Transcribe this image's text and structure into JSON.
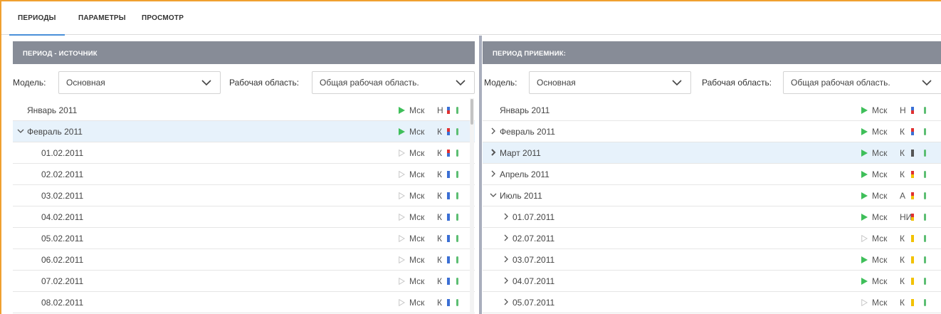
{
  "tabs": [
    {
      "label": "ПЕРИОДЫ",
      "active": true
    },
    {
      "label": "ПАРАМЕТРЫ",
      "active": false
    },
    {
      "label": "ПРОСМОТР",
      "active": false
    }
  ],
  "colors": {
    "accent": "#4a90d9",
    "frame": "#f0a030",
    "header_bg": "#878c97",
    "selected_row": "#e7f2fb",
    "play_active": "#3fbf5a",
    "play_inactive": "#c8c8c8",
    "status_pill": "#5cbe72"
  },
  "left": {
    "header": "ПЕРИОД - ИСТОЧНИК",
    "model_label": "Модель:",
    "model_value": "Основная",
    "workspace_label": "Рабочая область:",
    "workspace_value": "Общая рабочая область.",
    "rows": [
      {
        "label": "Январь 2011",
        "chevron": "none",
        "play": "active",
        "code": "Мск",
        "letter": "Н",
        "top": "#3b6fd4",
        "bottom": "#e03030",
        "selected": false,
        "indent": 0
      },
      {
        "label": "Февраль 2011",
        "chevron": "down",
        "play": "active",
        "code": "Мск",
        "letter": "К",
        "top": "#e03030",
        "bottom": "#3b6fd4",
        "selected": true,
        "indent": 0
      },
      {
        "label": "01.02.2011",
        "chevron": "none",
        "play": "inactive",
        "code": "Мск",
        "letter": "К",
        "top": "#e03030",
        "bottom": "#3b6fd4",
        "selected": false,
        "indent": 1
      },
      {
        "label": "02.02.2011",
        "chevron": "none",
        "play": "inactive",
        "code": "Мск",
        "letter": "К",
        "top": "#3b6fd4",
        "bottom": "#3b6fd4",
        "selected": false,
        "indent": 1
      },
      {
        "label": "03.02.2011",
        "chevron": "none",
        "play": "inactive",
        "code": "Мск",
        "letter": "К",
        "top": "#3b6fd4",
        "bottom": "#3b6fd4",
        "selected": false,
        "indent": 1
      },
      {
        "label": "04.02.2011",
        "chevron": "none",
        "play": "inactive",
        "code": "Мск",
        "letter": "К",
        "top": "#3b6fd4",
        "bottom": "#3b6fd4",
        "selected": false,
        "indent": 1
      },
      {
        "label": "05.02.2011",
        "chevron": "none",
        "play": "inactive",
        "code": "Мск",
        "letter": "К",
        "top": "#3b6fd4",
        "bottom": "#3b6fd4",
        "selected": false,
        "indent": 1
      },
      {
        "label": "06.02.2011",
        "chevron": "none",
        "play": "inactive",
        "code": "Мск",
        "letter": "К",
        "top": "#3b6fd4",
        "bottom": "#3b6fd4",
        "selected": false,
        "indent": 1
      },
      {
        "label": "07.02.2011",
        "chevron": "none",
        "play": "inactive",
        "code": "Мск",
        "letter": "К",
        "top": "#3b6fd4",
        "bottom": "#3b6fd4",
        "selected": false,
        "indent": 1
      },
      {
        "label": "08.02.2011",
        "chevron": "none",
        "play": "inactive",
        "code": "Мск",
        "letter": "К",
        "top": "#3b6fd4",
        "bottom": "#3b6fd4",
        "selected": false,
        "indent": 1
      }
    ]
  },
  "right": {
    "header": "ПЕРИОД ПРИЕМНИК:",
    "model_label": "Модель:",
    "model_value": "Основная",
    "workspace_label": "Рабочая область:",
    "workspace_value": "Общая рабочая область.",
    "rows": [
      {
        "label": "Январь 2011",
        "chevron": "none",
        "play": "active",
        "code": "Мск",
        "letter": "Н",
        "top": "#3b6fd4",
        "bottom": "#e03030",
        "selected": false,
        "indent": 0
      },
      {
        "label": "Февраль 2011",
        "chevron": "right",
        "play": "active",
        "code": "Мск",
        "letter": "К",
        "top": "#e03030",
        "bottom": "#3b6fd4",
        "selected": false,
        "indent": 0
      },
      {
        "label": "Март 2011",
        "chevron": "right-bold",
        "play": "active",
        "code": "Мск",
        "letter": "К",
        "top": "#555555",
        "bottom": "#555555",
        "selected": true,
        "indent": 0
      },
      {
        "label": "Апрель 2011",
        "chevron": "right",
        "play": "active",
        "code": "Мск",
        "letter": "К",
        "top": "#e03030",
        "bottom": "#f2c200",
        "selected": false,
        "indent": 0
      },
      {
        "label": "Июль 2011",
        "chevron": "down",
        "play": "active",
        "code": "Мск",
        "letter": "А",
        "top": "#e03030",
        "bottom": "#f2c200",
        "selected": false,
        "indent": 0
      },
      {
        "label": "01.07.2011",
        "chevron": "right",
        "play": "active",
        "code": "Мск",
        "letter": "НИ",
        "top": "#e03030",
        "bottom": "#f2c200",
        "selected": false,
        "indent": 1
      },
      {
        "label": "02.07.2011",
        "chevron": "right",
        "play": "inactive",
        "code": "Мск",
        "letter": "К",
        "top": "#f2c200",
        "bottom": "#f2c200",
        "selected": false,
        "indent": 1
      },
      {
        "label": "03.07.2011",
        "chevron": "right",
        "play": "active",
        "code": "Мск",
        "letter": "К",
        "top": "#f2c200",
        "bottom": "#f2c200",
        "selected": false,
        "indent": 1
      },
      {
        "label": "04.07.2011",
        "chevron": "right",
        "play": "active",
        "code": "Мск",
        "letter": "К",
        "top": "#f2c200",
        "bottom": "#f2c200",
        "selected": false,
        "indent": 1
      },
      {
        "label": "05.07.2011",
        "chevron": "right",
        "play": "inactive",
        "code": "Мск",
        "letter": "К",
        "top": "#f2c200",
        "bottom": "#f2c200",
        "selected": false,
        "indent": 1
      }
    ]
  }
}
